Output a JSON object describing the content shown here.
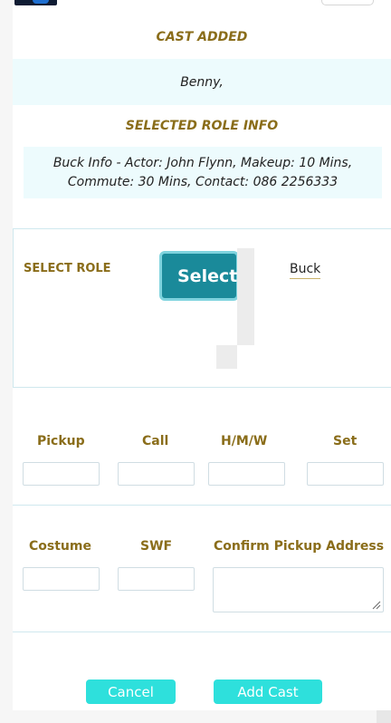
{
  "cast_added": {
    "title": "CAST ADDED",
    "names": "Benny,"
  },
  "role_info": {
    "title": "SELECTED ROLE INFO",
    "text": "Buck Info - Actor: John Flynn, Makeup: 10 Mins, Commute: 30 Mins, Contact: 086 2256333"
  },
  "select_role": {
    "label": "SELECT ROLE",
    "button_label": "Select",
    "selected_value": "Buck"
  },
  "times": {
    "pickup_label": "Pickup",
    "call_label": "Call",
    "hmw_label": "H/M/W",
    "set_label": "Set",
    "pickup_value": "",
    "call_value": "",
    "hmw_value": "",
    "set_value": ""
  },
  "extras": {
    "costume_label": "Costume",
    "swf_label": "SWF",
    "address_label": "Confirm Pickup Address",
    "costume_value": "",
    "swf_value": "",
    "address_value": ""
  },
  "actions": {
    "cancel_label": "Cancel",
    "add_label": "Add Cast"
  },
  "colors": {
    "accent_label": "#8a6d1a",
    "info_background": "#edfbfd",
    "select_button": "#1a8a9a",
    "action_button": "#2ee0dc"
  },
  "icons": {
    "logo": "app-logo",
    "resize": "resize-grip-icon"
  }
}
